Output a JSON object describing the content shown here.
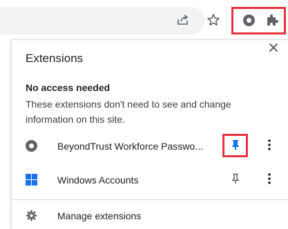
{
  "toolbar": {
    "icons": [
      "share-icon",
      "star-icon",
      "beyondtrust-icon",
      "puzzle-icon"
    ]
  },
  "panel": {
    "title": "Extensions",
    "close_icon": "close-icon",
    "section_heading": "No access needed",
    "section_desc": "These extensions don't need to see and change information on this site.",
    "extensions": [
      {
        "name": "BeyondTrust Workforce Passwo...",
        "icon": "beyondtrust-icon",
        "pinned": true,
        "pin_color": "#1a73e8"
      },
      {
        "name": "Windows Accounts",
        "icon": "windows-icon",
        "pinned": false,
        "pin_color": "#5f6368"
      }
    ],
    "manage_label": "Manage extensions",
    "manage_icon": "gear-icon"
  },
  "colors": {
    "highlight": "#e8323c",
    "accent": "#1a73e8",
    "icon_gray": "#5f6368"
  }
}
